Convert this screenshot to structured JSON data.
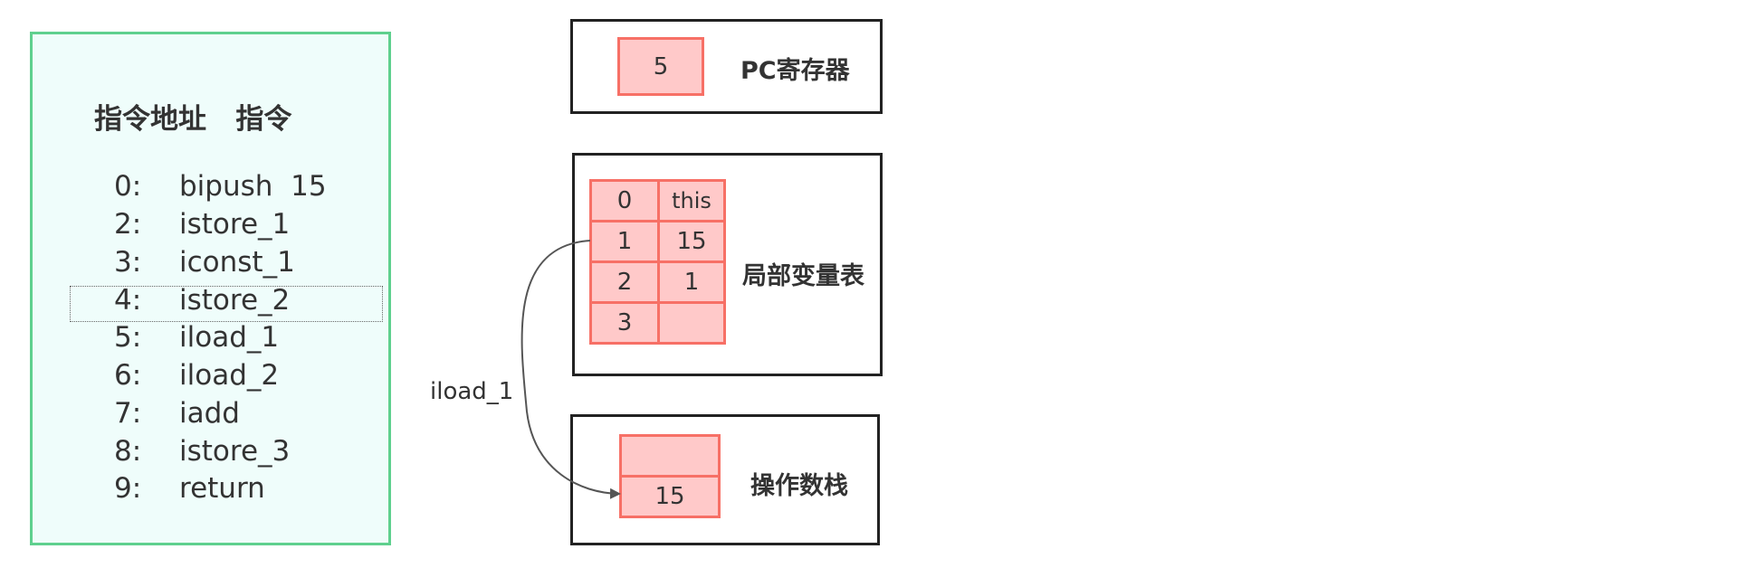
{
  "code": {
    "header": "指令地址   指令",
    "instructions": [
      {
        "addr": "0:",
        "op": "bipush  15"
      },
      {
        "addr": "2:",
        "op": "istore_1"
      },
      {
        "addr": "3:",
        "op": "iconst_1"
      },
      {
        "addr": "4:",
        "op": "istore_2"
      },
      {
        "addr": "5:",
        "op": "iload_1"
      },
      {
        "addr": "6:",
        "op": "iload_2"
      },
      {
        "addr": "7:",
        "op": "iadd"
      },
      {
        "addr": "8:",
        "op": "istore_3"
      },
      {
        "addr": "9:",
        "op": "return"
      }
    ],
    "highlighted_index": 4
  },
  "pc_register": {
    "value": "5",
    "label": "PC寄存器"
  },
  "local_vars": {
    "label": "局部变量表",
    "rows": [
      {
        "index": "0",
        "value": "this"
      },
      {
        "index": "1",
        "value": "15"
      },
      {
        "index": "2",
        "value": "1"
      },
      {
        "index": "3",
        "value": ""
      }
    ]
  },
  "operand_stack": {
    "label": "操作数栈",
    "cells": [
      "",
      "15"
    ]
  },
  "arrow": {
    "label": "iload_1"
  },
  "colors": {
    "panel_border": "#5fd08e",
    "panel_bg": "#effdfb",
    "cell_fill": "#ffc9c9",
    "cell_border": "#f77066"
  }
}
